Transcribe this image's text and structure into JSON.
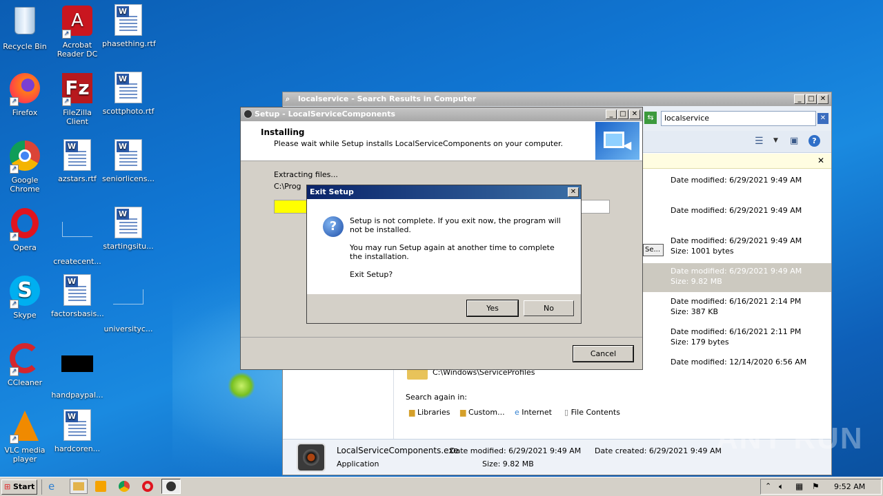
{
  "desktop": {
    "icons": [
      {
        "label": "Recycle Bin",
        "icon": "recycle-bin-icon"
      },
      {
        "label": "Acrobat Reader DC",
        "icon": "acrobat-icon"
      },
      {
        "label": "phasething.rtf",
        "icon": "word-doc-icon"
      },
      {
        "label": "Firefox",
        "icon": "firefox-icon"
      },
      {
        "label": "FileZilla Client",
        "icon": "filezilla-icon"
      },
      {
        "label": "scottphoto.rtf",
        "icon": "word-doc-icon"
      },
      {
        "label": "Google Chrome",
        "icon": "chrome-icon"
      },
      {
        "label": "azstars.rtf",
        "icon": "word-doc-icon"
      },
      {
        "label": "seniorlicens...",
        "icon": "word-doc-icon"
      },
      {
        "label": "Opera",
        "icon": "opera-icon"
      },
      {
        "label": "createcent...",
        "icon": "file-icon"
      },
      {
        "label": "startingsitu...",
        "icon": "word-doc-icon"
      },
      {
        "label": "Skype",
        "icon": "skype-icon"
      },
      {
        "label": "factorsbasis...",
        "icon": "word-doc-icon"
      },
      {
        "label": "universityc...",
        "icon": "file-icon"
      },
      {
        "label": "CCleaner",
        "icon": "ccleaner-icon"
      },
      {
        "label": "handpaypal...",
        "icon": "image-icon"
      },
      {
        "label": "VLC media player",
        "icon": "vlc-icon"
      },
      {
        "label": "hardcoren...",
        "icon": "word-doc-icon"
      }
    ]
  },
  "explorer": {
    "title": "localservice - Search Results in Computer",
    "search_value": "localservice",
    "results": [
      {
        "line1": "Date modified: 6/29/2021 9:49 AM",
        "line2": ""
      },
      {
        "line1": "Date modified: 6/29/2021 9:49 AM",
        "line2": ""
      },
      {
        "line1": "Date modified: 6/29/2021 9:49 AM",
        "line2": "Size: 1001 bytes"
      },
      {
        "line1": "Date modified: 6/29/2021 9:49 AM",
        "line2": "Size: 9.82 MB"
      },
      {
        "line1": "Date modified: 6/16/2021 2:14 PM",
        "line2": "Size: 387 KB"
      },
      {
        "line1": "Date modified: 6/16/2021 2:11 PM",
        "line2": "Size: 179 bytes"
      },
      {
        "line1": "Date modified: 12/14/2020 6:56 AM",
        "line2": ""
      }
    ],
    "partial_button": "Se...",
    "folder_path": "C:\\Windows\\ServiceProfiles",
    "search_again_label": "Search again in:",
    "search_again_items": [
      "Libraries",
      "Custom...",
      "Internet",
      "File Contents"
    ],
    "details": {
      "name": "LocalServiceComponents.exe",
      "type": "Application",
      "modified": "Date modified: 6/29/2021 9:49 AM",
      "size": "Size: 9.82 MB",
      "created": "Date created: 6/29/2021 9:49 AM"
    }
  },
  "setup": {
    "title": "Setup - LocalServiceComponents",
    "heading": "Installing",
    "subheading": "Please wait while Setup installs LocalServiceComponents on your computer.",
    "status": "Extracting files...",
    "path": "C:\\Prog",
    "cancel_label": "Cancel",
    "progress": 0.1
  },
  "exit_dialog": {
    "title": "Exit Setup",
    "message1": "Setup is not complete. If you exit now, the program will not be installed.",
    "message2": "You may run Setup again at another time to complete the installation.",
    "question": "Exit Setup?",
    "yes_label": "Yes",
    "no_label": "No"
  },
  "taskbar": {
    "start_label": "Start",
    "clock": "9:52 AM"
  },
  "watermark": "ANY RUN"
}
